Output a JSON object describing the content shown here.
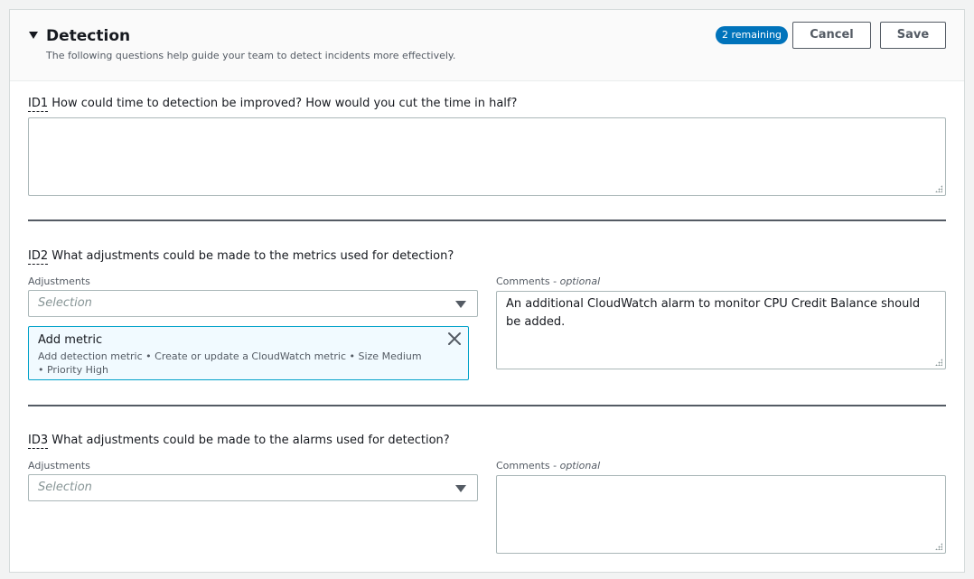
{
  "header": {
    "title": "Detection",
    "subtitle": "The following questions help guide your team to detect incidents more effectively.",
    "badge": "2 remaining",
    "cancel_label": "Cancel",
    "save_label": "Save"
  },
  "questions": [
    {
      "id": "ID1",
      "text": " How could time to detection be improved? How would you cut the time in half?",
      "answer": ""
    },
    {
      "id": "ID2",
      "text": " What adjustments could be made to the metrics used for detection?",
      "adjustments_label": "Adjustments",
      "select_placeholder": "Selection",
      "comments_label": "Comments",
      "comments_optional": "optional",
      "comments_value": "An additional CloudWatch alarm to monitor CPU Credit Balance should be added.",
      "token": {
        "title": "Add metric",
        "description": "Add detection metric • Create or update a CloudWatch metric • Size Medium • Priority High"
      }
    },
    {
      "id": "ID3",
      "text": " What adjustments could be made to the alarms used for detection?",
      "adjustments_label": "Adjustments",
      "select_placeholder": "Selection",
      "comments_label": "Comments",
      "comments_optional": "optional",
      "comments_value": ""
    }
  ],
  "icons": {
    "collapse": "caret-down-icon",
    "dropdown": "caret-down-icon",
    "remove": "close-icon",
    "resize": "resize-grip-icon"
  },
  "colors": {
    "badge": "#0073bb",
    "token_border": "#00a1c9",
    "token_bg": "#f1faff"
  }
}
